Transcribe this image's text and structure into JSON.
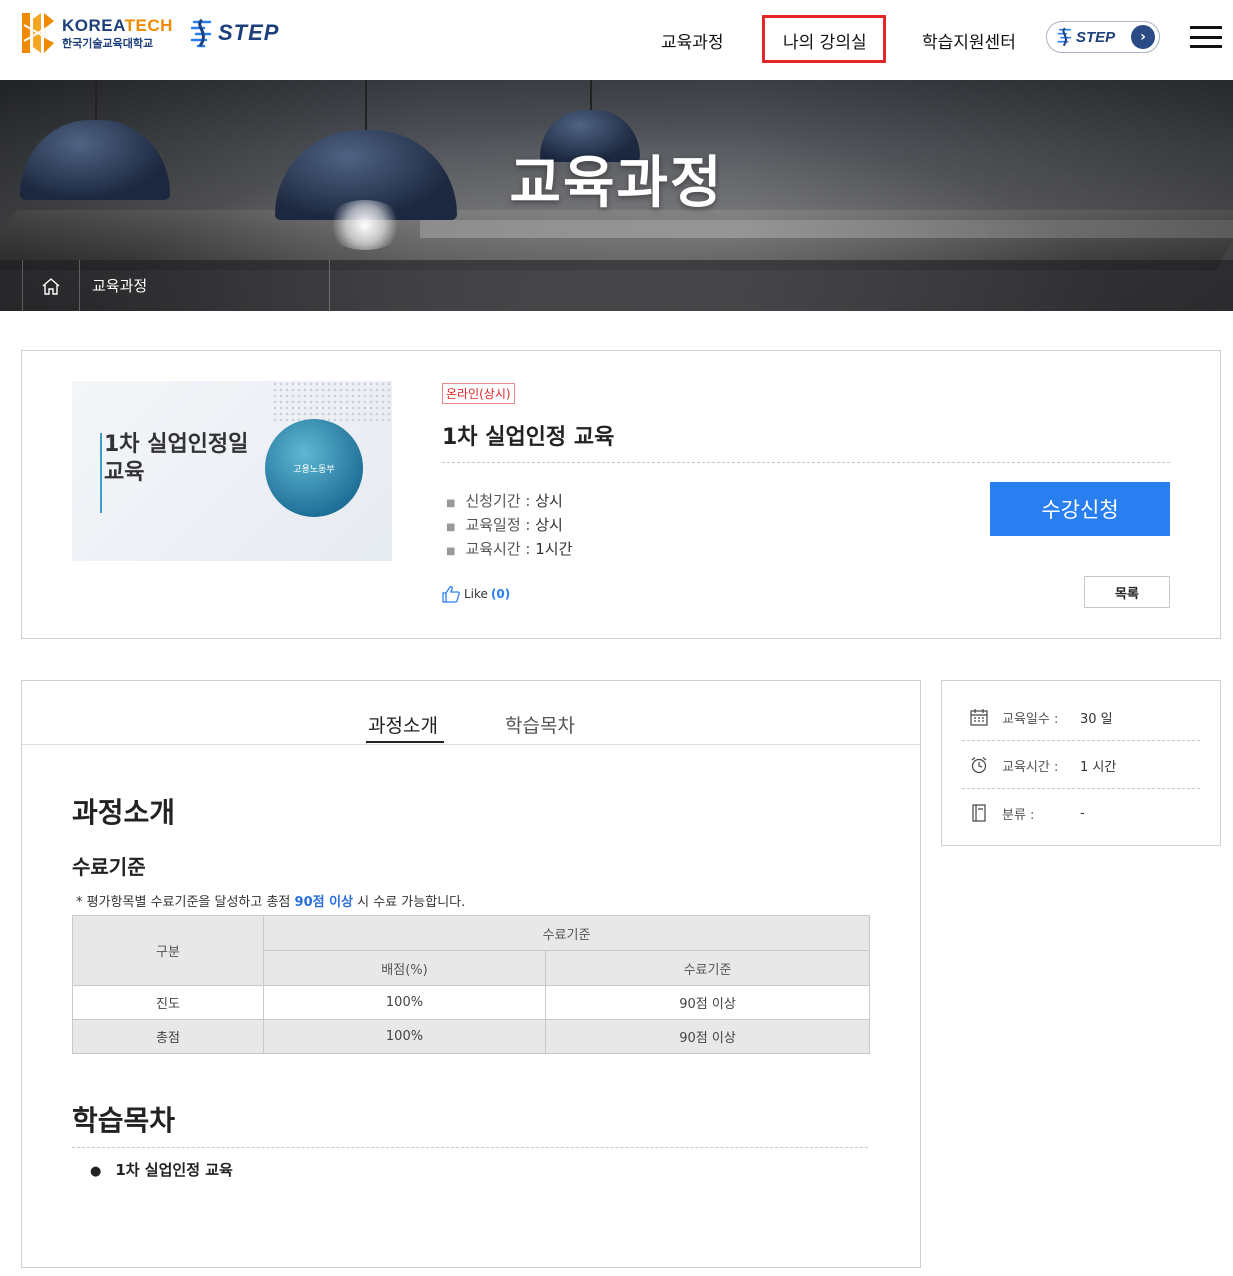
{
  "header": {
    "logo_en_1": "KOREA",
    "logo_en_2": "TECH",
    "logo_ko": "한국기술교육대학교",
    "step_logo": "STEP",
    "nav": [
      "교육과정",
      "나의 강의실",
      "학습지원센터"
    ],
    "step_button": "STEP",
    "active_highlight_color": "#e3262a"
  },
  "hero": {
    "title": "교육과정",
    "breadcrumb": "교육과정"
  },
  "course": {
    "thumbnail_title": "1차 실업인정일 교육",
    "thumbnail_ministry": "고용노동부",
    "badge": "온라인(상시)",
    "title": "1차 실업인정 교육",
    "info": [
      {
        "label": "신청기간",
        "sep": " : ",
        "value": "상시"
      },
      {
        "label": "교육일정",
        "sep": " : ",
        "value": "상시"
      },
      {
        "label": "교육시간",
        "sep": " : ",
        "value": "1시간"
      }
    ],
    "enroll_button": "수강신청",
    "like_label": "Like",
    "like_count": "(0)",
    "list_button": "목록",
    "accent_color": "#2a7ff0"
  },
  "tabs": [
    "과정소개",
    "학습목차"
  ],
  "intro": {
    "heading": "과정소개",
    "criteria_heading": "수료기준",
    "note_prefix": "* 평가항목별 수료기준을 달성하고 총점 ",
    "note_bold": "90점 이상",
    "note_suffix": " 시 수료 가능합니다.",
    "table": {
      "col_category": "구분",
      "group_header": "수료기준",
      "col_score": "배점(%)",
      "col_criteria": "수료기준",
      "rows": [
        {
          "category": "진도",
          "score": "100%",
          "criteria": "90점 이상"
        },
        {
          "category": "총점",
          "score": "100%",
          "criteria": "90점 이상"
        }
      ]
    }
  },
  "toc": {
    "heading": "학습목차",
    "items": [
      "1차 실업인정 교육"
    ]
  },
  "side": {
    "rows": [
      {
        "icon": "calendar-icon",
        "label": "교육일수 :",
        "value": "30 일"
      },
      {
        "icon": "alarm-clock-icon",
        "label": "교육시간 :",
        "value": "1 시간"
      },
      {
        "icon": "book-icon",
        "label": "분류 :",
        "value": "-"
      }
    ]
  }
}
